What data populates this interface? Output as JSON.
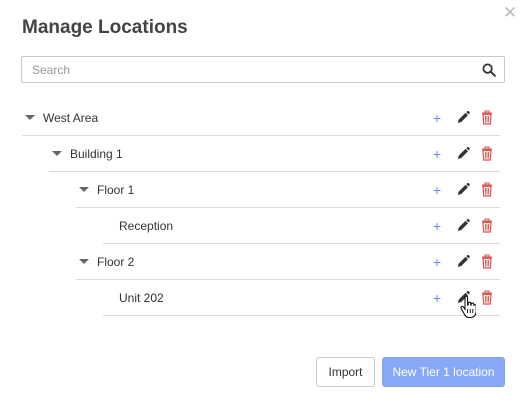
{
  "modal": {
    "title": "Manage Locations",
    "close_glyph": "✕"
  },
  "search": {
    "placeholder": "Search",
    "value": ""
  },
  "tree": {
    "items": [
      {
        "label": "West Area",
        "level": 0,
        "expanded": true,
        "has_children": true
      },
      {
        "label": "Building 1",
        "level": 1,
        "expanded": true,
        "has_children": true
      },
      {
        "label": "Floor 1",
        "level": 2,
        "expanded": true,
        "has_children": true
      },
      {
        "label": "Reception",
        "level": 3,
        "expanded": false,
        "has_children": false
      },
      {
        "label": "Floor 2",
        "level": 2,
        "expanded": true,
        "has_children": true
      },
      {
        "label": "Unit 202",
        "level": 3,
        "expanded": false,
        "has_children": false
      }
    ],
    "add_glyph": "+"
  },
  "footer": {
    "import_label": "Import",
    "new_label": "New Tier 1 location"
  },
  "colors": {
    "add_icon": "#6f86d6",
    "edit_icon": "#333333",
    "delete_icon": "#d9534f",
    "primary_button": "#87a8f5"
  },
  "icons": {
    "caret": "caret-down-icon",
    "add": "plus-icon",
    "edit": "pencil-icon",
    "delete": "trash-icon",
    "search": "search-icon",
    "close": "close-icon"
  }
}
